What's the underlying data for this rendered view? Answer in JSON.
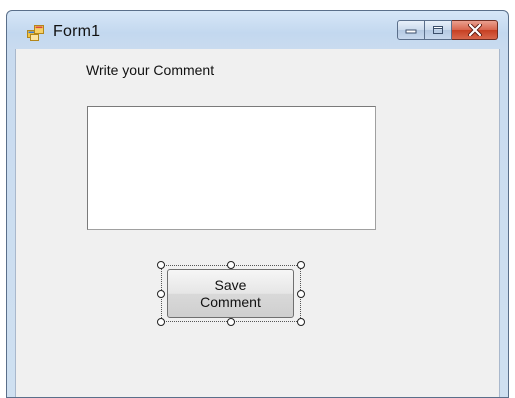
{
  "window": {
    "title": "Form1",
    "icon": "winforms-app-icon",
    "caption_buttons": [
      "minimize-icon",
      "maximize-icon",
      "close-icon"
    ]
  },
  "form": {
    "label": "Write your Comment",
    "comment_textbox": {
      "value": ""
    },
    "save_button": {
      "line1": "Save",
      "line2": "Comment",
      "selected_in_designer": true
    }
  },
  "colors": {
    "client_background": "#f0f0f0",
    "titlebar": "#c9dbef",
    "close_button": "#c63f22"
  }
}
